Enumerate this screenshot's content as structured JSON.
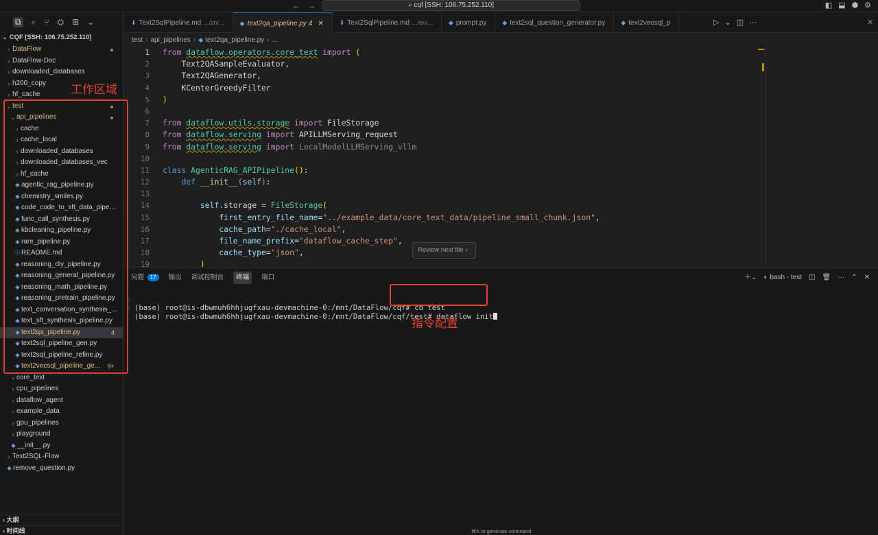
{
  "titlebar": {
    "command_center": "cqf [SSH: 106.75.252.110]"
  },
  "sidebar": {
    "root_label": "CQF [SSH: 106.75.252.110]",
    "tree": [
      {
        "label": "DataFlow",
        "indent": 0,
        "kind": "folder",
        "open": false,
        "modified": true
      },
      {
        "label": "DataFlow-Doc",
        "indent": 0,
        "kind": "folder",
        "open": false
      },
      {
        "label": "downloaded_databases",
        "indent": 0,
        "kind": "folder",
        "open": false
      },
      {
        "label": "h200_copy",
        "indent": 0,
        "kind": "folder",
        "open": false
      },
      {
        "label": "hf_cache",
        "indent": 0,
        "kind": "folder",
        "open": false
      },
      {
        "label": "test",
        "indent": 0,
        "kind": "folder",
        "open": true,
        "modified": true
      },
      {
        "label": "api_pipelines",
        "indent": 1,
        "kind": "folder",
        "open": true,
        "modified": true
      },
      {
        "label": "cache",
        "indent": 2,
        "kind": "folder",
        "open": false
      },
      {
        "label": "cache_local",
        "indent": 2,
        "kind": "folder",
        "open": false
      },
      {
        "label": "downloaded_databases",
        "indent": 2,
        "kind": "folder",
        "open": false
      },
      {
        "label": "downloaded_databases_vec",
        "indent": 2,
        "kind": "folder",
        "open": false
      },
      {
        "label": "hf_cache",
        "indent": 2,
        "kind": "folder",
        "open": false
      },
      {
        "label": "agentic_rag_pipeline.py",
        "indent": 2,
        "kind": "py"
      },
      {
        "label": "chemistry_smiles.py",
        "indent": 2,
        "kind": "py"
      },
      {
        "label": "code_code_to_sft_data_pipeli...",
        "indent": 2,
        "kind": "py"
      },
      {
        "label": "func_call_synthesis.py",
        "indent": 2,
        "kind": "py"
      },
      {
        "label": "kbcleaning_pipeline.py",
        "indent": 2,
        "kind": "py"
      },
      {
        "label": "rare_pipeline.py",
        "indent": 2,
        "kind": "py"
      },
      {
        "label": "README.md",
        "indent": 2,
        "kind": "info"
      },
      {
        "label": "reasoning_diy_pipeline.py",
        "indent": 2,
        "kind": "py"
      },
      {
        "label": "reasoning_general_pipeline.py",
        "indent": 2,
        "kind": "py"
      },
      {
        "label": "reasoning_math_pipeline.py",
        "indent": 2,
        "kind": "py"
      },
      {
        "label": "reasoning_pretrain_pipeline.py",
        "indent": 2,
        "kind": "py"
      },
      {
        "label": "text_conversation_synthesis_...",
        "indent": 2,
        "kind": "py"
      },
      {
        "label": "text_sft_synthesis_pipeline.py",
        "indent": 2,
        "kind": "py"
      },
      {
        "label": "text2qa_pipeline.py",
        "indent": 2,
        "kind": "py",
        "modified": true,
        "selected": true,
        "count": "4"
      },
      {
        "label": "text2sql_pipeline_gen.py",
        "indent": 2,
        "kind": "py"
      },
      {
        "label": "text2sql_pipeline_refine.py",
        "indent": 2,
        "kind": "py"
      },
      {
        "label": "text2vecsql_pipeline_ge...",
        "indent": 2,
        "kind": "py",
        "modified": true,
        "count": "9+"
      },
      {
        "label": "core_text",
        "indent": 1,
        "kind": "folder",
        "open": false
      },
      {
        "label": "cpu_pipelines",
        "indent": 1,
        "kind": "folder",
        "open": false
      },
      {
        "label": "dataflow_agent",
        "indent": 1,
        "kind": "folder",
        "open": false
      },
      {
        "label": "example_data",
        "indent": 1,
        "kind": "folder",
        "open": false
      },
      {
        "label": "gpu_pipelines",
        "indent": 1,
        "kind": "folder",
        "open": false
      },
      {
        "label": "playground",
        "indent": 1,
        "kind": "folder",
        "open": false
      },
      {
        "label": "__init__.py",
        "indent": 1,
        "kind": "py"
      },
      {
        "label": "Text2SQL-Flow",
        "indent": 0,
        "kind": "folder",
        "open": false
      },
      {
        "label": "remove_question.py",
        "indent": 0,
        "kind": "py"
      }
    ],
    "outline_label": "大纲",
    "timeline_label": "时间线"
  },
  "tabs": [
    {
      "icon": "markdown",
      "label": "Text2SqlPipeline.md",
      "path": ".../zh/...",
      "active": false
    },
    {
      "icon": "python",
      "label": "text2qa_pipeline.py",
      "count": "4",
      "active": true
    },
    {
      "icon": "markdown",
      "label": "Text2SqlPipeline.md",
      "path": ".../en/...",
      "active": false
    },
    {
      "icon": "python",
      "label": "prompt.py",
      "active": false
    },
    {
      "icon": "python",
      "label": "text2sql_question_generator.py",
      "active": false
    },
    {
      "icon": "python",
      "label": "text2vecsql_p",
      "active": false
    }
  ],
  "breadcrumb": [
    "test",
    "api_pipelines",
    "text2qa_pipeline.py",
    "..."
  ],
  "code_lines": [
    [
      [
        "kw2",
        "from "
      ],
      [
        "mod",
        "dataflow.operators.core_text"
      ],
      [
        "kw2",
        " import "
      ],
      [
        "paren",
        "("
      ]
    ],
    [
      [
        "",
        "    Text2QASampleEvaluator,"
      ]
    ],
    [
      [
        "",
        "    Text2QAGenerator,"
      ]
    ],
    [
      [
        "",
        "    KCenterGreedyFilter"
      ]
    ],
    [
      [
        "paren",
        ")"
      ]
    ],
    [],
    [
      [
        "kw2",
        "from "
      ],
      [
        "mod",
        "dataflow.utils.storage"
      ],
      [
        "kw2",
        " import "
      ],
      [
        "",
        "FileStorage"
      ]
    ],
    [
      [
        "kw2",
        "from "
      ],
      [
        "mod",
        "dataflow.serving"
      ],
      [
        "kw2",
        " import "
      ],
      [
        "",
        "APILLMServing_request"
      ]
    ],
    [
      [
        "kw2",
        "from "
      ],
      [
        "mod",
        "dataflow.serving"
      ],
      [
        "kw2",
        " import "
      ],
      [
        "dim",
        "LocalModelLLMServing_vllm"
      ]
    ],
    [],
    [
      [
        "kw",
        "class "
      ],
      [
        "cls",
        "AgenticRAG_APIPipeline"
      ],
      [
        "paren",
        "()"
      ],
      [
        "",
        ":"
      ]
    ],
    [
      [
        "",
        "    "
      ],
      [
        "kw",
        "def "
      ],
      [
        "fn",
        "__init__"
      ],
      [
        "kw2",
        "("
      ],
      [
        "prm",
        "self"
      ],
      [
        "kw2",
        ")"
      ],
      [
        "",
        ":"
      ]
    ],
    [],
    [
      [
        "",
        "        "
      ],
      [
        "prm",
        "self"
      ],
      [
        "",
        ".storage = "
      ],
      [
        "cls",
        "FileStorage"
      ],
      [
        "paren",
        "("
      ]
    ],
    [
      [
        "",
        "            "
      ],
      [
        "prm",
        "first_entry_file_name"
      ],
      [
        "",
        "="
      ],
      [
        "str",
        "\"../example_data/core_text_data/pipeline_small_chunk.json\""
      ],
      [
        "",
        ","
      ]
    ],
    [
      [
        "",
        "            "
      ],
      [
        "prm",
        "cache_path"
      ],
      [
        "",
        "="
      ],
      [
        "str",
        "\"./cache_local\""
      ],
      [
        "",
        ","
      ]
    ],
    [
      [
        "",
        "            "
      ],
      [
        "prm",
        "file_name_prefix"
      ],
      [
        "",
        "="
      ],
      [
        "str",
        "\"dataflow_cache_step\""
      ],
      [
        "",
        ","
      ]
    ],
    [
      [
        "",
        "            "
      ],
      [
        "prm",
        "cache_type"
      ],
      [
        "",
        "="
      ],
      [
        "str",
        "\"json\""
      ],
      [
        "",
        ","
      ]
    ],
    [
      [
        "",
        "        "
      ],
      [
        "paren",
        ")"
      ]
    ]
  ],
  "review_chip": "Review next file",
  "panel": {
    "tabs": [
      "问题",
      "输出",
      "调试控制台",
      "终端",
      "端口"
    ],
    "problems_badge": "17",
    "active_tab": "终端",
    "terminal_name": "bash - test",
    "lines": [
      "(base) root@is-dbwmuh6hhjugfxau-devmachine-0:/mnt/DataFlow/cqf# cd test",
      "(base) root@is-dbwmuh6hhjugfxau-devmachine-0:/mnt/DataFlow/cqf/test# dataflow init"
    ],
    "footer_hint": "⌘K to generate command"
  },
  "annotations": {
    "workspace_label": "工作区域",
    "command_label": "指令配置",
    "color": "#e0412e"
  }
}
